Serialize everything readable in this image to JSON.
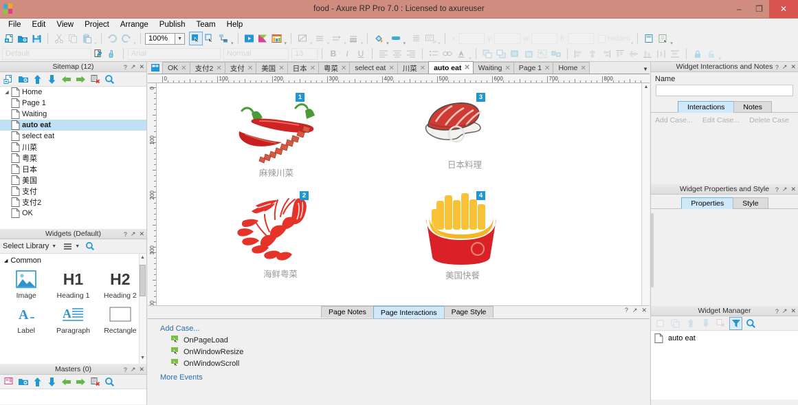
{
  "window": {
    "title": "food - Axure RP Pro 7.0 : Licensed to axureuser",
    "minimize": "–",
    "maximize": "❐",
    "close": "✕"
  },
  "menu": [
    "File",
    "Edit",
    "View",
    "Project",
    "Arrange",
    "Publish",
    "Team",
    "Help"
  ],
  "toolbar": {
    "zoom": "100%",
    "style_default": "Default",
    "font": "Arial",
    "font_style": "Normal",
    "font_size": "13",
    "x_label": "x:",
    "y_label": "y:",
    "w_label": "w:",
    "h_label": "h:",
    "hidden_label": "Hidden",
    "bold": "B",
    "italic": "I",
    "underline": "U"
  },
  "sitemap": {
    "title": "Sitemap (12)",
    "items": [
      {
        "label": "Home",
        "level": 0,
        "selected": false,
        "expander": true
      },
      {
        "label": "Page 1",
        "level": 1,
        "selected": false
      },
      {
        "label": "Waiting",
        "level": 1,
        "selected": false
      },
      {
        "label": "auto eat",
        "level": 1,
        "selected": true
      },
      {
        "label": "select eat",
        "level": 1,
        "selected": false
      },
      {
        "label": "川菜",
        "level": 1,
        "selected": false
      },
      {
        "label": "粤菜",
        "level": 1,
        "selected": false
      },
      {
        "label": "日本",
        "level": 1,
        "selected": false
      },
      {
        "label": "美国",
        "level": 1,
        "selected": false
      },
      {
        "label": "支付",
        "level": 1,
        "selected": false
      },
      {
        "label": "支付2",
        "level": 1,
        "selected": false
      },
      {
        "label": "OK",
        "level": 1,
        "selected": false
      }
    ]
  },
  "widgets": {
    "title": "Widgets (Default)",
    "select_library": "Select Library",
    "category": "Common",
    "items": [
      {
        "label": "Image",
        "icon": "image-icon"
      },
      {
        "label": "Heading 1",
        "icon": "h1-icon"
      },
      {
        "label": "Heading 2",
        "icon": "h2-icon"
      },
      {
        "label": "Label",
        "icon": "label-icon"
      },
      {
        "label": "Paragraph",
        "icon": "paragraph-icon"
      },
      {
        "label": "Rectangle",
        "icon": "rectangle-icon"
      }
    ]
  },
  "masters": {
    "title": "Masters (0)"
  },
  "tabs": [
    {
      "label": "OK",
      "active": false
    },
    {
      "label": "支付2",
      "active": false
    },
    {
      "label": "支付",
      "active": false
    },
    {
      "label": "美国",
      "active": false
    },
    {
      "label": "日本",
      "active": false
    },
    {
      "label": "粤菜",
      "active": false
    },
    {
      "label": "select eat",
      "active": false
    },
    {
      "label": "川菜",
      "active": false
    },
    {
      "label": "auto eat",
      "active": true
    },
    {
      "label": "Waiting",
      "active": false
    },
    {
      "label": "Page 1",
      "active": false
    },
    {
      "label": "Home",
      "active": false
    }
  ],
  "rulers": {
    "horizontal": [
      "0",
      "100",
      "200",
      "300",
      "400",
      "500",
      "600",
      "700",
      "800"
    ],
    "vertical": [
      "0",
      "100",
      "200",
      "300"
    ]
  },
  "canvas": {
    "items": [
      {
        "caption": "麻辣川菜",
        "badge": "1",
        "icon": "chili-pepper-image"
      },
      {
        "caption": "日本料理",
        "badge": "3",
        "icon": "sushi-image"
      },
      {
        "caption": "海鲜粤菜",
        "badge": "2",
        "icon": "shrimp-image"
      },
      {
        "caption": "美国快餐",
        "badge": "4",
        "icon": "fries-image"
      }
    ]
  },
  "page_panel": {
    "tabs": [
      {
        "label": "Page Notes",
        "active": false
      },
      {
        "label": "Page Interactions",
        "active": true
      },
      {
        "label": "Page Style",
        "active": false
      }
    ],
    "add_case": "Add Case...",
    "events": [
      "OnPageLoad",
      "OnWindowResize",
      "OnWindowScroll"
    ],
    "more_events": "More Events"
  },
  "widget_interactions": {
    "title": "Widget Interactions and Notes",
    "name_label": "Name",
    "name_value": "",
    "tabs": [
      {
        "label": "Interactions",
        "active": true
      },
      {
        "label": "Notes",
        "active": false
      }
    ],
    "actions": [
      "Add Case...",
      "Edit Case...",
      "Delete Case"
    ]
  },
  "widget_properties": {
    "title": "Widget Properties and Style",
    "tabs": [
      {
        "label": "Properties",
        "active": true
      },
      {
        "label": "Style",
        "active": false
      }
    ]
  },
  "widget_manager": {
    "title": "Widget Manager",
    "items": [
      "auto eat"
    ]
  },
  "panel_buttons": {
    "help": "?",
    "float": "↗",
    "close": "✕"
  },
  "colors": {
    "titlebar": "#cf8c7f",
    "close_button": "#d9534f",
    "accent": "#2196d4",
    "selection": "#bfe0f5",
    "link": "#2a6ea8",
    "active_tab_fill": "#cfe9fa"
  }
}
